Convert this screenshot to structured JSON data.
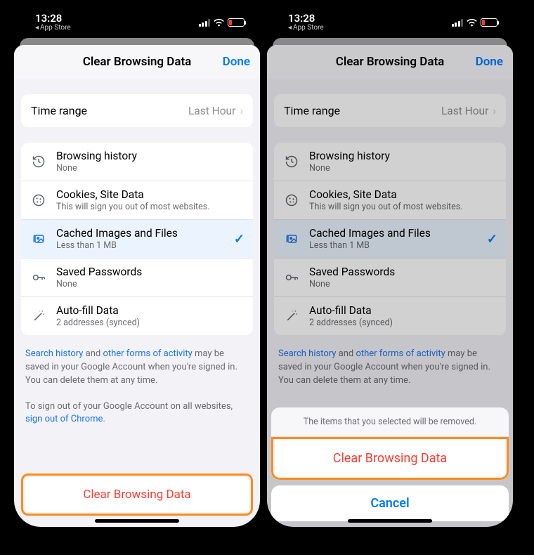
{
  "status": {
    "time": "13:28",
    "back_label": "App Store"
  },
  "sheet": {
    "title": "Clear Browsing Data",
    "done": "Done"
  },
  "time_range": {
    "label": "Time range",
    "value": "Last Hour"
  },
  "items": [
    {
      "title": "Browsing history",
      "sub": "None",
      "selected": false,
      "icon": "history"
    },
    {
      "title": "Cookies, Site Data",
      "sub": "This will sign you out of most websites.",
      "selected": false,
      "icon": "cookie"
    },
    {
      "title": "Cached Images and Files",
      "sub": "Less than 1 MB",
      "selected": true,
      "icon": "images"
    },
    {
      "title": "Saved Passwords",
      "sub": "None",
      "selected": false,
      "icon": "key"
    },
    {
      "title": "Auto-fill Data",
      "sub": "2 addresses (synced)",
      "selected": false,
      "icon": "wand"
    }
  ],
  "notes": {
    "search_history_link": "Search history",
    "and": " and ",
    "other_forms_link": "other forms of activity",
    "rest1": " may be saved in your Google Account when you're signed in. You can delete them at any time.",
    "signout_pre": "To sign out of your Google Account on all websites, ",
    "signout_link": "sign out of Chrome",
    "signout_post": "."
  },
  "clear_button": "Clear Browsing Data",
  "action_sheet": {
    "message": "The items that you selected will be removed.",
    "confirm": "Clear Browsing Data",
    "cancel": "Cancel"
  }
}
